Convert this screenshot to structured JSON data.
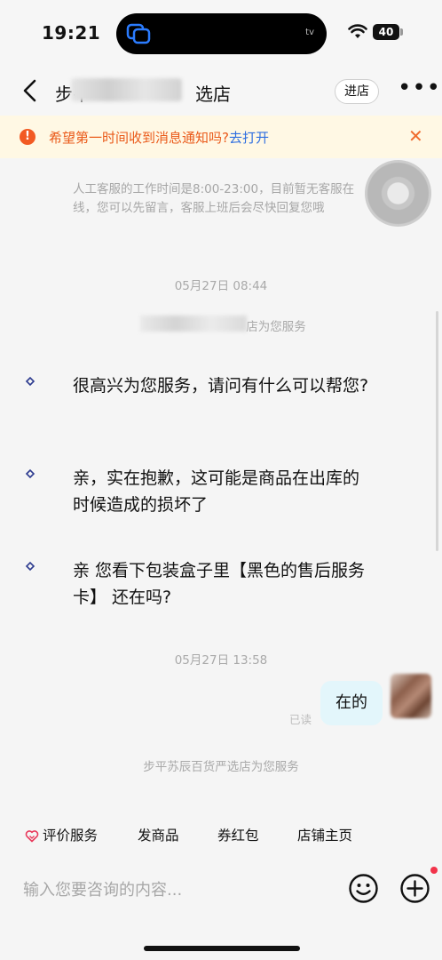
{
  "status_bar": {
    "time": "19:21",
    "tv_label": "tv",
    "battery": "40"
  },
  "header": {
    "title": "步平苏辰百货严选店",
    "title_visible_start": "步平",
    "title_visible_end": "选店",
    "enter_store": "进店",
    "more": "•••"
  },
  "notice": {
    "text": "希望第一时间收到消息通知吗?",
    "link": "去打开",
    "close": "✕",
    "icon": "!"
  },
  "messages": {
    "system_notice": "人工客服的工作时间是8:00-23:00，目前暂无客服在线，您可以先留言，客服上班后会尽快回复您哦",
    "timestamp_1": "05月27日 08:44",
    "service_note_1_end": "店为您服务",
    "agent_msg_1": "很高兴为您服务，请问有什么可以帮您?",
    "agent_msg_2": "亲，实在抱歉，这可能是商品在出库的时候造成的损坏了",
    "agent_msg_3": "亲  您看下包装盒子里【黑色的售后服务卡】 还在吗?",
    "timestamp_2": "05月27日 13:58",
    "my_msg": "在的",
    "read_status": "已读",
    "service_note_2": "步平苏辰百货严选店为您服务"
  },
  "quick_actions": {
    "review": "评价服务",
    "send_product": "发商品",
    "coupon": "券红包",
    "shop_home": "店铺主页"
  },
  "input": {
    "placeholder": "输入您要咨询的内容..."
  },
  "colors": {
    "notice_bg": "#fff8e4",
    "notice_text": "#ea5a1a",
    "link": "#2f6fe0",
    "my_bubble": "#e3f6fb",
    "accent_red": "#f2334a"
  }
}
